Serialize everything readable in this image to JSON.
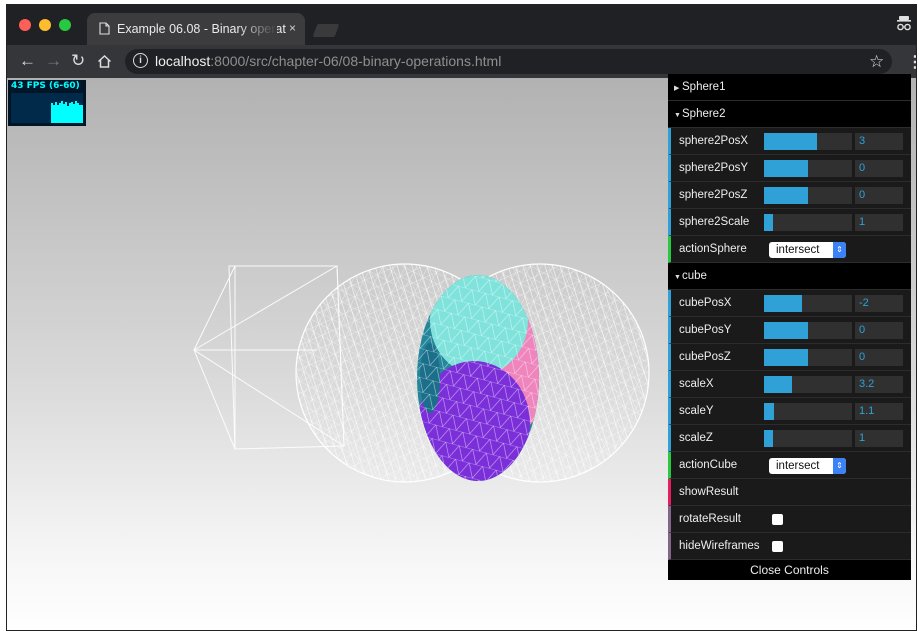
{
  "window": {
    "tab_title": "Example 06.08 - Binary operat",
    "tab_close": "×"
  },
  "address_bar": {
    "host": "localhost",
    "path": ":8000/src/chapter-06/08-binary-operations.html"
  },
  "stats": {
    "fps": "43 FPS (6-60)"
  },
  "controls": {
    "folders": {
      "sphere1": "Sphere1",
      "sphere2": "Sphere2",
      "cube": "cube"
    },
    "sphere2": [
      {
        "label": "sphere2PosX",
        "value": "3",
        "fill": 0.6
      },
      {
        "label": "sphere2PosY",
        "value": "0",
        "fill": 0.5
      },
      {
        "label": "sphere2PosZ",
        "value": "0",
        "fill": 0.5
      },
      {
        "label": "sphere2Scale",
        "value": "1",
        "fill": 0.1
      }
    ],
    "action_sphere": {
      "label": "actionSphere",
      "value": "intersect"
    },
    "cube": [
      {
        "label": "cubePosX",
        "value": "-2",
        "fill": 0.43
      },
      {
        "label": "cubePosY",
        "value": "0",
        "fill": 0.5
      },
      {
        "label": "cubePosZ",
        "value": "0",
        "fill": 0.5
      },
      {
        "label": "scaleX",
        "value": "3.2",
        "fill": 0.32
      },
      {
        "label": "scaleY",
        "value": "1.1",
        "fill": 0.11
      },
      {
        "label": "scaleZ",
        "value": "1",
        "fill": 0.1
      }
    ],
    "action_cube": {
      "label": "actionCube",
      "value": "intersect"
    },
    "show_result": "showResult",
    "rotate_result": {
      "label": "rotateResult",
      "checked": false
    },
    "hide_wireframes": {
      "label": "hideWireframes",
      "checked": false
    },
    "close_label": "Close Controls"
  },
  "colors": {
    "accent_number": "#2fa1d6",
    "accent_boolean": "#806787",
    "accent_function": "#e61d5f",
    "result_top": "#7fe3dc",
    "result_bottom": "#7b2fd9"
  }
}
